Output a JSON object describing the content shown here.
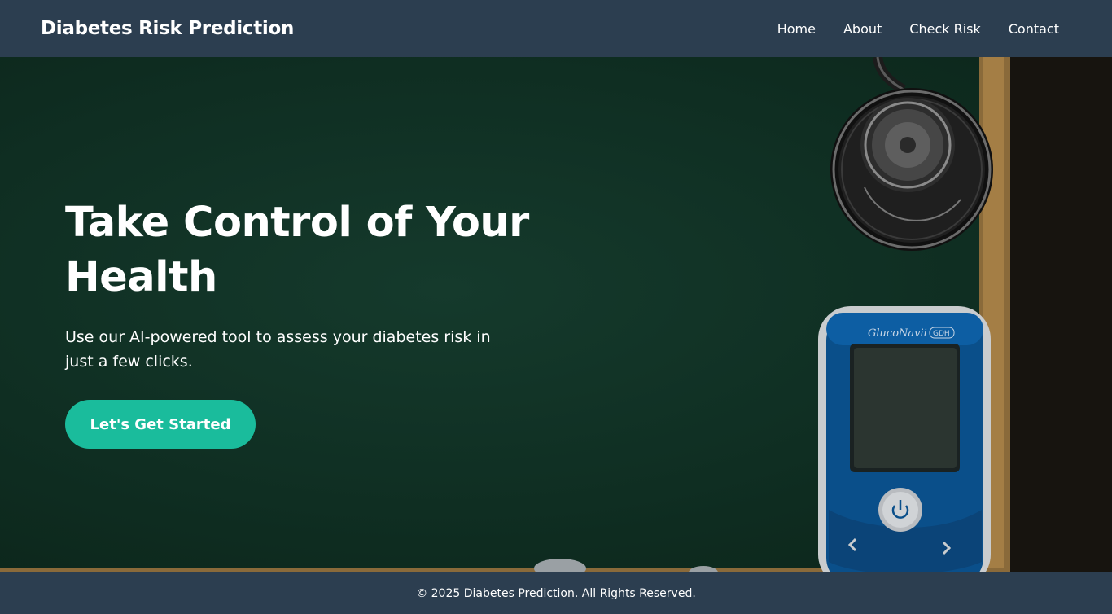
{
  "navbar": {
    "brand": "Diabetes Risk Prediction",
    "links": [
      "Home",
      "About",
      "Check Risk",
      "Contact"
    ]
  },
  "hero": {
    "title": "Take Control of Your Health",
    "subtitle": "Use our AI-powered tool to assess your diabetes risk in just a few clicks.",
    "cta_label": "Let's Get Started",
    "meter_brand": "GlucoNavii",
    "meter_model": "GDH"
  },
  "footer": {
    "text": "© 2025 Diabetes Prediction. All Rights Reserved."
  },
  "colors": {
    "navbar_bg": "#2c3e50",
    "accent": "#1abc9c",
    "hero_bg": "#0f2e22"
  },
  "icons": [
    "power-icon",
    "chevron-left-icon",
    "chevron-right-icon"
  ]
}
